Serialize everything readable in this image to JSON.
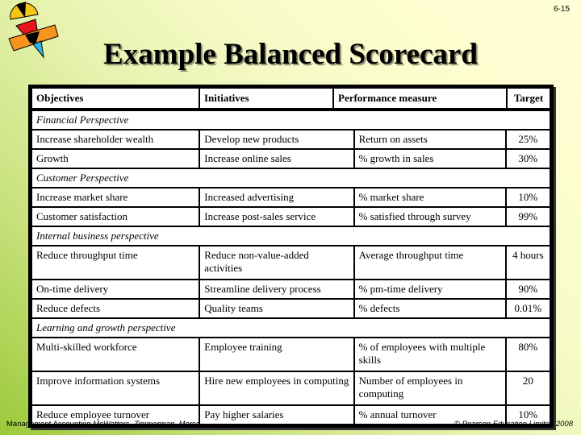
{
  "slide_number": "6-15",
  "title": "Example Balanced Scorecard",
  "table": {
    "headers": [
      "Objectives",
      "Initiatives",
      "Performance measure",
      "Target"
    ],
    "sections": [
      {
        "name": "Financial Perspective",
        "rows": [
          {
            "objective": "Increase shareholder wealth",
            "initiative": "Develop new products",
            "measure": "Return on assets",
            "target": "25%"
          },
          {
            "objective": "Growth",
            "initiative": "Increase online sales",
            "measure": "% growth in sales",
            "target": "30%"
          }
        ]
      },
      {
        "name": "Customer Perspective",
        "rows": [
          {
            "objective": "Increase market share",
            "initiative": "Increased advertising",
            "measure": "% market share",
            "target": "10%"
          },
          {
            "objective": "Customer satisfaction",
            "initiative": "Increase post-sales service",
            "measure": "% satisfied through survey",
            "target": "99%"
          }
        ]
      },
      {
        "name": "Internal business perspective",
        "rows": [
          {
            "objective": "Reduce throughput time",
            "initiative": "Reduce non-value-added activities",
            "measure": "Average throughput time",
            "target": "4 hours"
          },
          {
            "objective": "On-time delivery",
            "initiative": "Streamline delivery process",
            "measure": "% pm-time delivery",
            "target": "90%"
          },
          {
            "objective": "Reduce defects",
            "initiative": "Quality teams",
            "measure": "% defects",
            "target": "0.01%"
          }
        ]
      },
      {
        "name": "Learning and growth perspective",
        "rows": [
          {
            "objective": "Multi-skilled workforce",
            "initiative": "Employee training",
            "measure": "% of employees with multiple skills",
            "target": "80%"
          },
          {
            "objective": "Improve information systems",
            "initiative": "Hire new employees in computing",
            "measure": "Number of employees in computing",
            "target": "20"
          },
          {
            "objective": "Reduce employee turnover",
            "initiative": "Pay higher salaries",
            "measure": "% annual turnover",
            "target": "10%"
          }
        ]
      }
    ]
  },
  "footer": {
    "book": "Management Accounting",
    "authors": [
      "McWatters",
      "Zimmerman",
      "Morse"
    ],
    "copyright": "© Pearson Education Limited 2008"
  },
  "logo": {
    "icon": "geometric-shapes-logo",
    "colors": [
      "#f5c518",
      "#e8141b",
      "#f7941d",
      "#29b6e8",
      "#000000"
    ]
  }
}
